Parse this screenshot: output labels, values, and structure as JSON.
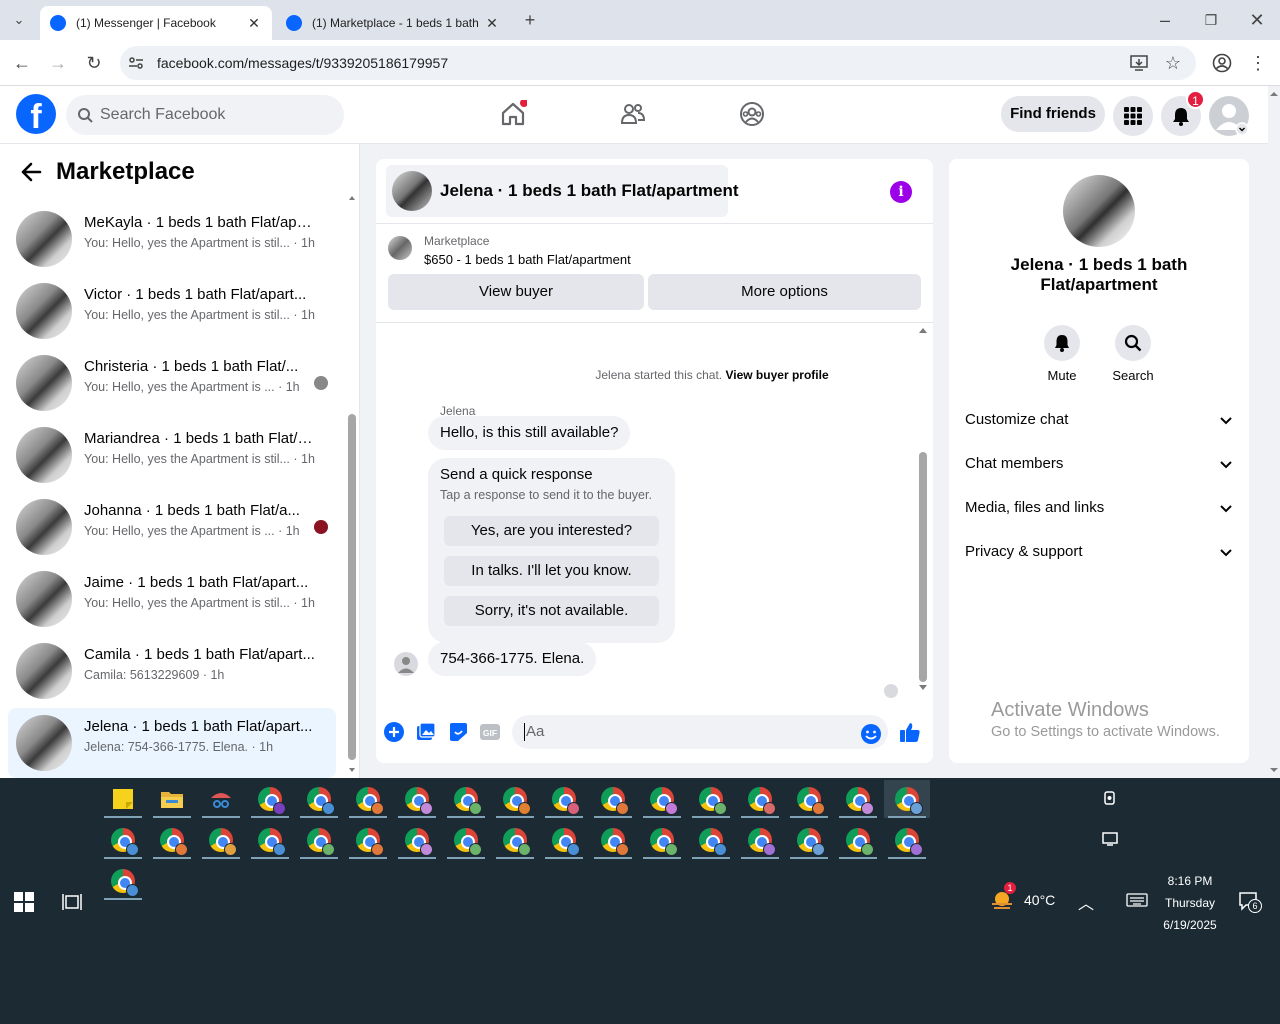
{
  "browser": {
    "tabs": [
      {
        "title": "(1) Messenger | Facebook",
        "active": true
      },
      {
        "title": "(1) Marketplace - 1 beds 1 bath",
        "active": false
      }
    ],
    "url": "facebook.com/messages/t/9339205186179957"
  },
  "fb_header": {
    "logo": "f",
    "search_placeholder": "Search Facebook",
    "find_friends": "Find friends",
    "notification_count": "1"
  },
  "left_panel": {
    "title": "Marketplace",
    "conversations": [
      {
        "name": "MeKayla · 1 beds 1 bath Flat/apa...",
        "preview": "You: Hello, yes the Apartment is stil... · 1h",
        "selected": false
      },
      {
        "name": "Victor · 1 beds 1 bath Flat/apart...",
        "preview": "You: Hello, yes the Apartment is stil... · 1h",
        "selected": false
      },
      {
        "name": "Christeria · 1 beds 1 bath Flat/...",
        "preview": "You: Hello, yes the Apartment is ... · 1h",
        "selected": false
      },
      {
        "name": "Mariandrea · 1 beds 1 bath Flat/a...",
        "preview": "You: Hello, yes the Apartment is stil... · 1h",
        "selected": false
      },
      {
        "name": "Johanna · 1 beds 1 bath Flat/a...",
        "preview": "You: Hello, yes the Apartment is ... · 1h",
        "selected": false
      },
      {
        "name": "Jaime · 1 beds 1 bath Flat/apart...",
        "preview": "You: Hello, yes the Apartment is stil... · 1h",
        "selected": false
      },
      {
        "name": "Camila · 1 beds 1 bath Flat/apart...",
        "preview": "Camila: 5613229609 · 1h",
        "selected": false
      },
      {
        "name": "Jelena · 1 beds 1 bath Flat/apart...",
        "preview": "Jelena: 754-366-1775. Elena. · 1h",
        "selected": true
      }
    ]
  },
  "chat": {
    "title": "Jelena · 1 beds 1 bath Flat/apartment",
    "listing_source": "Marketplace",
    "listing_price": "$650 - 1 beds 1 bath Flat/apartment",
    "view_buyer": "View buyer",
    "more_options": "More options",
    "started_text": "Jelena started this chat.",
    "started_link": "View buyer profile",
    "sender_name": "Jelena",
    "msg1": "Hello, is this still available?",
    "quick_title": "Send a quick response",
    "quick_sub": "Tap a response to send it to the buyer.",
    "quick_responses": [
      "Yes, are you interested?",
      "In talks. I'll let you know.",
      "Sorry, it's not available."
    ],
    "msg2": "754-366-1775.  Elena.",
    "input_placeholder": "Aa",
    "gif_label": "GIF"
  },
  "right_panel": {
    "name": "Jelena · 1 beds 1 bath Flat/apartment",
    "mute": "Mute",
    "search": "Search",
    "sections": [
      "Customize chat",
      "Chat members",
      "Media, files and links",
      "Privacy & support"
    ],
    "activate_title": "Activate Windows",
    "activate_sub": "Go to Settings to activate Windows."
  },
  "taskbar": {
    "weather_temp": "40°C",
    "weather_badge": "1",
    "time": "8:16 PM",
    "day": "Thursday",
    "date": "6/19/2025",
    "notif_count": "6",
    "profile_colors": [
      "#7a3fbf",
      "#4a8fd6",
      "#e0783a",
      "#c28ad8",
      "#6bb26b",
      "#e08030",
      "#d8607a",
      "#e0783a",
      "#c47ad6",
      "#6bb26b",
      "#d86a6a",
      "#e0783a",
      "#c28ad8",
      "#6aa0d6",
      "#4a8fd6",
      "#e0783a",
      "#e0a040",
      "#4a8fd6",
      "#6bb26b",
      "#e0783a",
      "#c28ad8",
      "#6bb26b",
      "#6bb26b",
      "#4a8fd6",
      "#e0783a",
      "#6bb26b",
      "#4a8fd6",
      "#a070d6",
      "#6aa0d6",
      "#6bb26b",
      "#a070d6",
      "#4a8fd6"
    ]
  }
}
